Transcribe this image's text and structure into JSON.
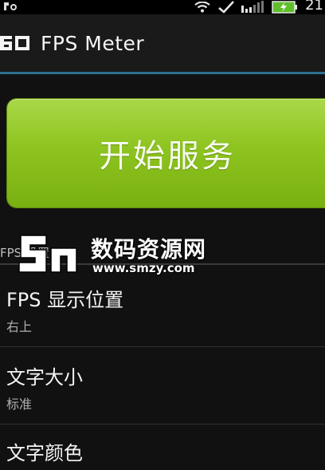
{
  "status_bar": {
    "time": "21"
  },
  "app_bar": {
    "logo_text": "60",
    "title": "FPS Meter"
  },
  "start_button": {
    "label": "开始服务"
  },
  "settings": {
    "section_title": "FPS 设置",
    "items": [
      {
        "title": "FPS 显示位置",
        "summary": "右上"
      },
      {
        "title": "文字大小",
        "summary": "标准"
      },
      {
        "title": "文字颜色"
      }
    ]
  },
  "watermark": {
    "text": "数码资源网",
    "url": "www.smzy.com"
  }
}
